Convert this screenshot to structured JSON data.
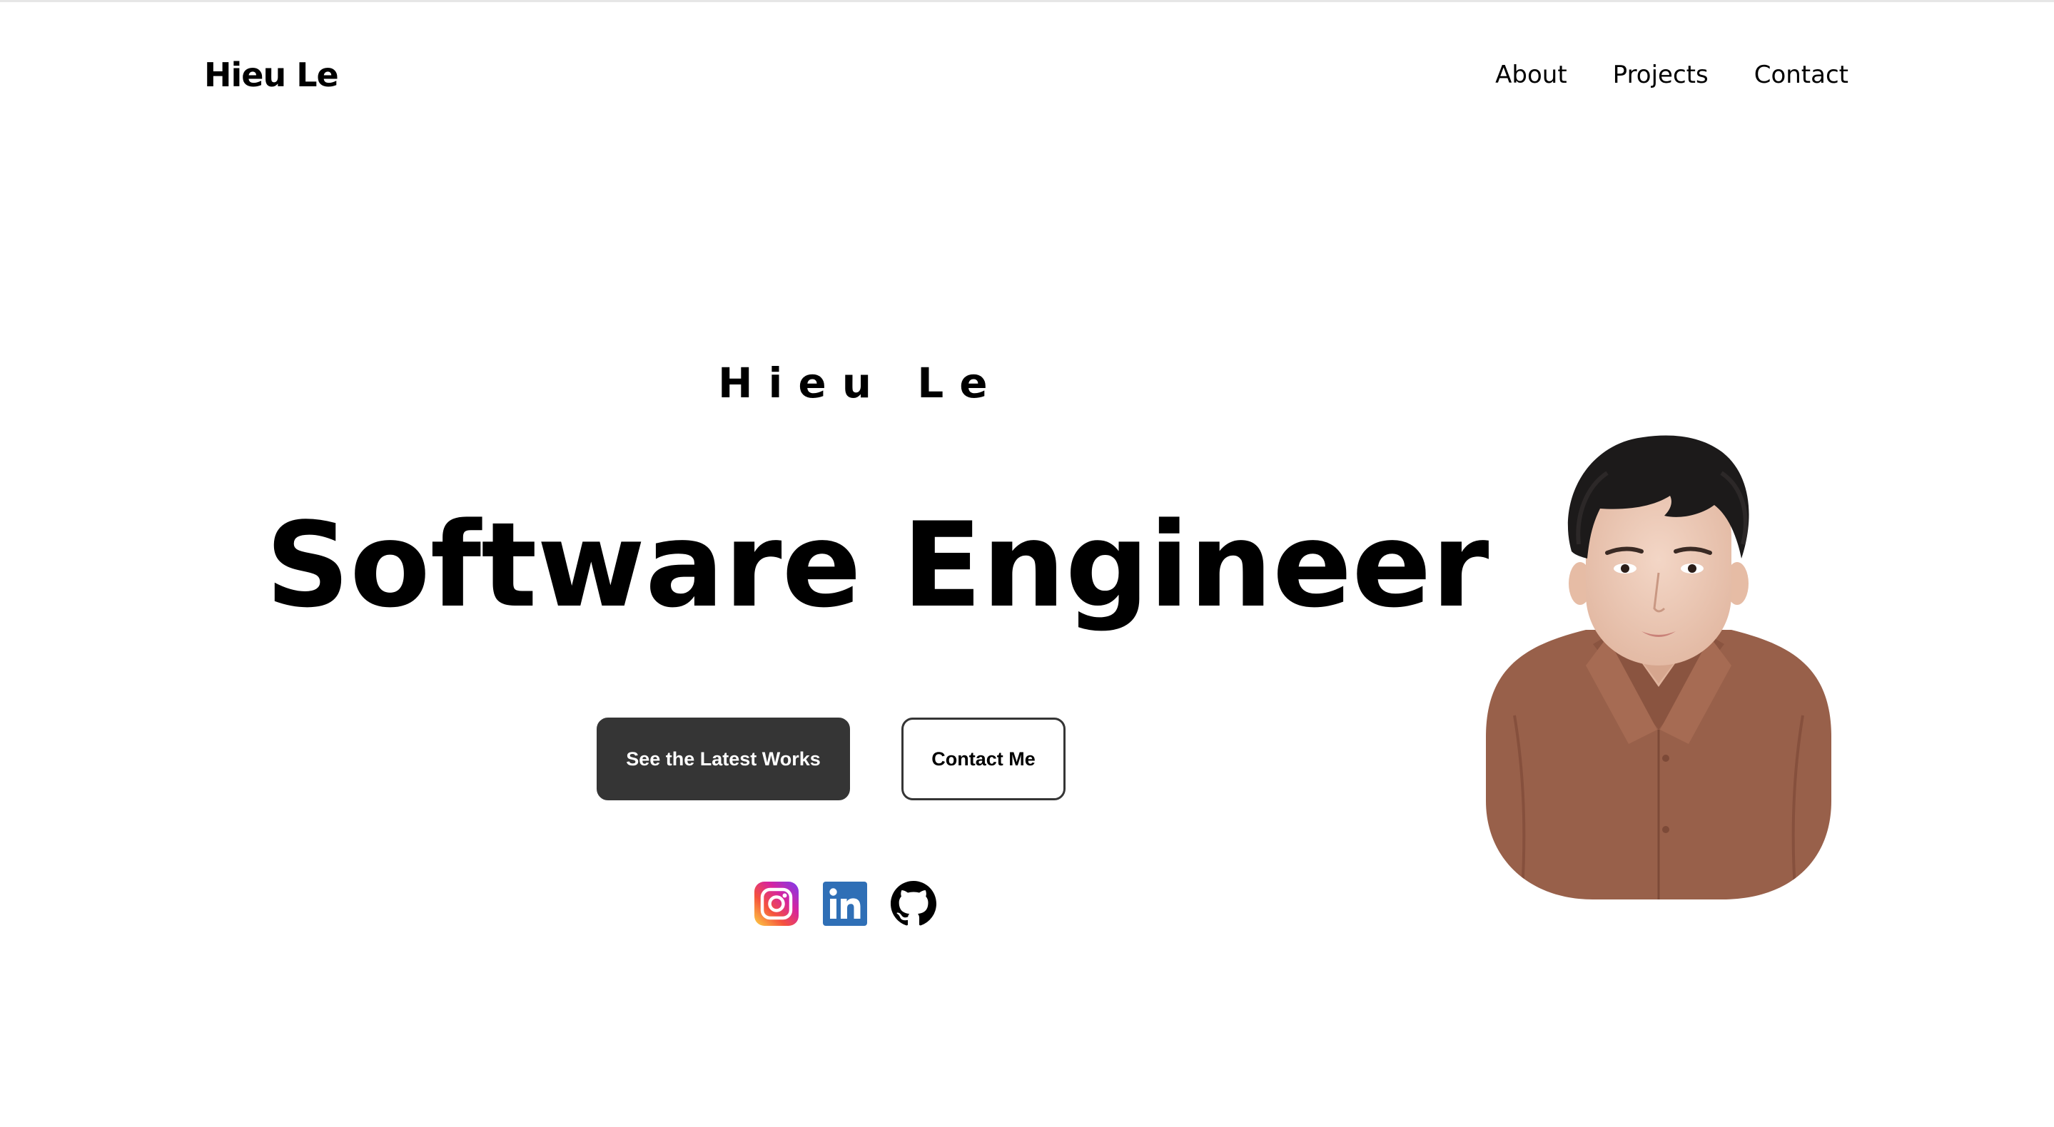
{
  "header": {
    "logo": "Hieu Le",
    "nav": [
      {
        "label": "About"
      },
      {
        "label": "Projects"
      },
      {
        "label": "Contact"
      }
    ]
  },
  "hero": {
    "name": "Hieu Le",
    "title": "Software Engineer",
    "primary_button": "See the Latest Works",
    "secondary_button": "Contact Me",
    "socials": [
      {
        "icon": "instagram-icon"
      },
      {
        "icon": "linkedin-icon"
      },
      {
        "icon": "github-icon"
      }
    ]
  },
  "colors": {
    "background": "#ffffff",
    "text": "#000000",
    "primary_button_bg": "#353535",
    "linkedin_blue": "#2f6fb6",
    "shirt_brown": "#98604a"
  }
}
